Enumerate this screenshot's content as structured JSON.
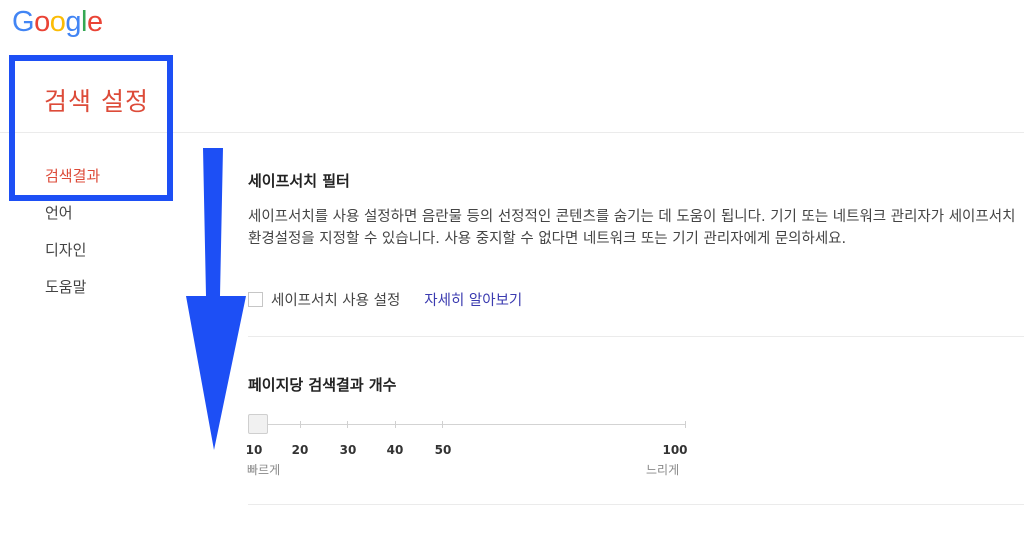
{
  "logo": {
    "letters": [
      "G",
      "o",
      "o",
      "g",
      "l",
      "e"
    ],
    "colors": [
      "#4285f4",
      "#ea4335",
      "#fbbc05",
      "#4285f4",
      "#34a853",
      "#ea4335"
    ]
  },
  "page": {
    "title": "검색 설정"
  },
  "nav": {
    "items": [
      {
        "label": "검색결과",
        "active": true
      },
      {
        "label": "언어"
      },
      {
        "label": "디자인"
      },
      {
        "label": "도움말"
      }
    ]
  },
  "safesearch": {
    "title": "세이프서치 필터",
    "description": "세이프서치를 사용 설정하면 음란물 등의 선정적인 콘텐츠를 숨기는 데 도움이 됩니다. 기기 또는 네트워크 관리자가 세이프서치 환경설정을 지정할 수 있습니다. 사용 중지할 수 없다면 네트워크 또는 기기 관리자에게 문의하세요.",
    "checkbox_label": "세이프서치 사용 설정",
    "checked": false,
    "learn_more": "자세히 알아보기"
  },
  "results_per_page": {
    "title": "페이지당 검색결과 개수",
    "ticks": [
      "10",
      "20",
      "30",
      "40",
      "50",
      "100"
    ],
    "value": 10,
    "fast_label": "빠르게",
    "slow_label": "느리게"
  },
  "colors": {
    "accent": "#dd4b39",
    "link": "#3b3bb0",
    "highlight": "#1d4ff5"
  }
}
